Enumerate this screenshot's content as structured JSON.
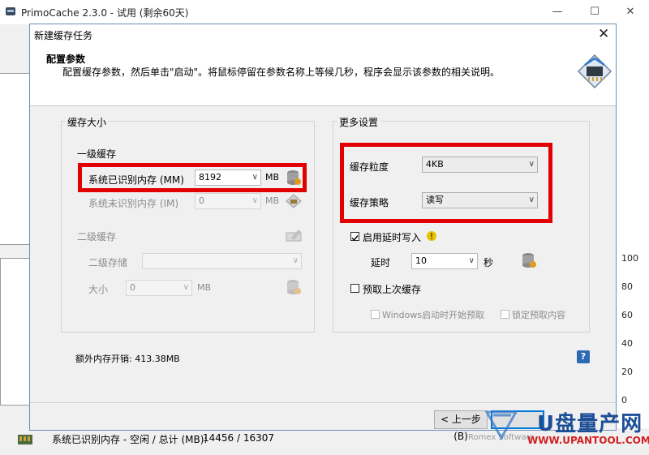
{
  "main_window": {
    "title": "PrimoCache 2.3.0 - 试用 (剩余60天)",
    "status_label": "系统已识别内存 - 空闲 / 总计 (MB):",
    "status_value": "14456 / 16307",
    "footer_text": "Romex Software",
    "axis_values": [
      "100",
      "80",
      "60",
      "40",
      "20",
      "0"
    ]
  },
  "dialog": {
    "title": "新建缓存任务",
    "header": {
      "title": "配置参数",
      "description": "配置缓存参数，然后单击\"启动\"。将鼠标停留在参数名称上等候几秒，程序会显示该参数的相关说明。"
    },
    "cache_size": {
      "group_title": "缓存大小",
      "level1_title": "一级缓存",
      "recognized_label": "系统已识别内存 (MM)",
      "recognized_value": "8192",
      "recognized_unit": "MB",
      "unrecognized_label": "系统未识别内存 (IM)",
      "unrecognized_value": "0",
      "unrecognized_unit": "MB",
      "level2_title": "二级缓存",
      "level2_storage_label": "二级存储",
      "level2_size_label": "大小",
      "level2_size_value": "0",
      "level2_size_unit": "MB",
      "overhead": "额外内存开销: 413.38MB"
    },
    "more_settings": {
      "group_title": "更多设置",
      "granularity_label": "缓存粒度",
      "granularity_value": "4KB",
      "strategy_label": "缓存策略",
      "strategy_value": "读写",
      "defer_write_label": "启用延时写入",
      "defer_write_checked": true,
      "delay_label": "延时",
      "delay_value": "10",
      "delay_unit": "秒",
      "prefetch_label": "预取上次缓存",
      "prefetch_checked": false,
      "prefetch_on_start_label": "Windows启动时开始预取",
      "lock_prefetch_label": "锁定预取内容"
    },
    "buttons": {
      "back": "< 上一步(B)",
      "help": "?"
    }
  },
  "watermark": {
    "brand": "U盘量产网",
    "url": "WWW.UPANTOOL.COM"
  },
  "colors": {
    "highlight": "#e30000",
    "dialog_border": "#6d8fb8",
    "help_blue": "#2d6ab4",
    "warning_yellow": "#e8c400"
  }
}
